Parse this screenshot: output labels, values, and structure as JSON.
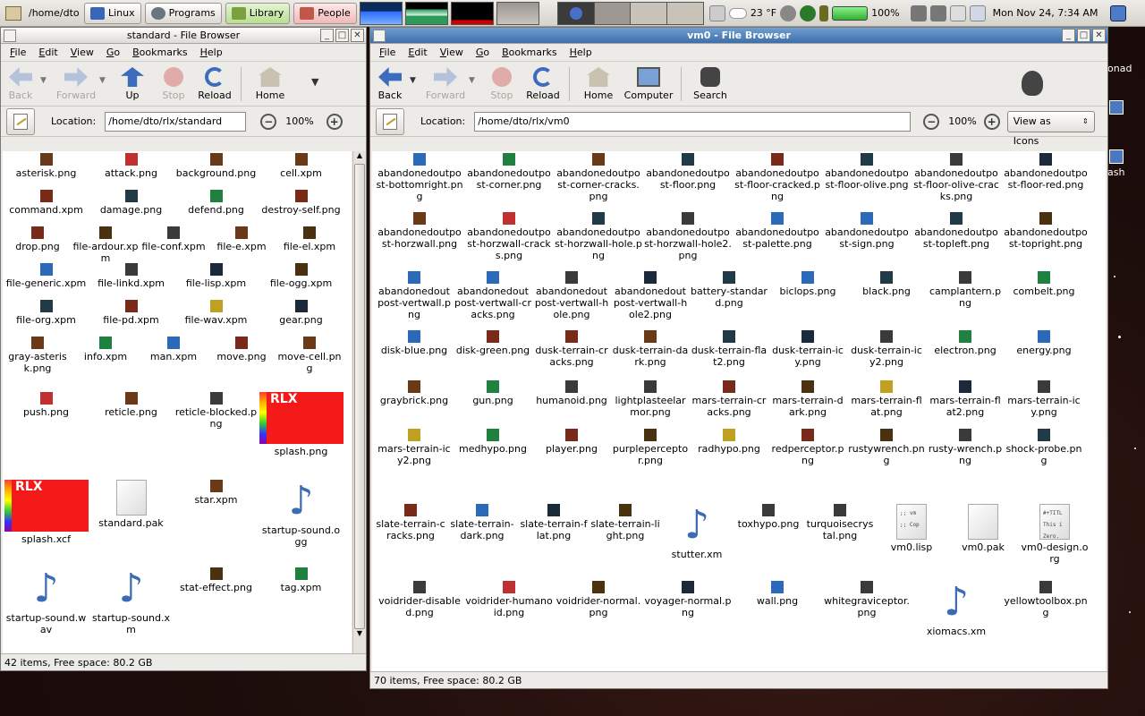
{
  "panel": {
    "path": "/home/dto",
    "buttons": [
      "Linux",
      "Programs",
      "Library",
      "People"
    ],
    "weather": "23 °F",
    "battery": "100%",
    "datetime": "Mon Nov 24,  7:34 AM"
  },
  "desktop": {
    "items": [
      "onad",
      "ash"
    ]
  },
  "left_window": {
    "title": "standard - File Browser",
    "menu": [
      "File",
      "Edit",
      "View",
      "Go",
      "Bookmarks",
      "Help"
    ],
    "toolbar": {
      "back": "Back",
      "forward": "Forward",
      "up": "Up",
      "stop": "Stop",
      "reload": "Reload",
      "home": "Home"
    },
    "location_label": "Location:",
    "location_value": "/home/dto/rlx/standard",
    "zoom": "100%",
    "status": "42 items, Free space: 80.2 GB",
    "files": [
      "asterisk.png",
      "attack.png",
      "background.png",
      "cell.xpm",
      "command.xpm",
      "damage.png",
      "defend.png",
      "destroy-self.png",
      "drop.png",
      "file-ardour.xpm",
      "file-conf.xpm",
      "file-e.xpm",
      "file-el.xpm",
      "file-generic.xpm",
      "file-linkd.xpm",
      "file-lisp.xpm",
      "file-ogg.xpm",
      "file-org.xpm",
      "file-pd.xpm",
      "file-wav.xpm",
      "gear.png",
      "gray-asterisk.png",
      "info.xpm",
      "man.xpm",
      "move.png",
      "move-cell.png",
      "push.png",
      "reticle.png",
      "reticle-blocked.png",
      "splash.png",
      "splash.xcf",
      "standard.pak",
      "star.xpm",
      "startup-sound.ogg",
      "startup-sound.wav",
      "startup-sound.xm",
      "stat-effect.png",
      "tag.xpm"
    ]
  },
  "right_window": {
    "title": "vm0 - File Browser",
    "menu": [
      "File",
      "Edit",
      "View",
      "Go",
      "Bookmarks",
      "Help"
    ],
    "toolbar": {
      "back": "Back",
      "forward": "Forward",
      "stop": "Stop",
      "reload": "Reload",
      "home": "Home",
      "computer": "Computer",
      "search": "Search"
    },
    "location_label": "Location:",
    "location_value": "/home/dto/rlx/vm0",
    "zoom": "100%",
    "view_mode": "View as Icons",
    "status": "70 items, Free space: 80.2 GB",
    "files": [
      "abandonedoutpost-bottomright.png",
      "abandonedoutpost-corner.png",
      "abandonedoutpost-corner-cracks.png",
      "abandonedoutpost-floor.png",
      "abandonedoutpost-floor-cracked.png",
      "abandonedoutpost-floor-olive.png",
      "abandonedoutpost-floor-olive-cracks.png",
      "abandonedoutpost-floor-red.png",
      "abandonedoutpost-horzwall.png",
      "abandonedoutpost-horzwall-cracks.png",
      "abandonedoutpost-horzwall-hole.png",
      "abandonedoutpost-horzwall-hole2.png",
      "abandonedoutpost-palette.png",
      "abandonedoutpost-sign.png",
      "abandonedoutpost-topleft.png",
      "abandonedoutpost-topright.png",
      "abandonedoutpost-vertwall.png",
      "abandonedoutpost-vertwall-cracks.png",
      "abandonedoutpost-vertwall-hole.png",
      "abandonedoutpost-vertwall-hole2.png",
      "battery-standard.png",
      "biclops.png",
      "black.png",
      "camplantern.png",
      "combelt.png",
      "disk-blue.png",
      "disk-green.png",
      "dusk-terrain-cracks.png",
      "dusk-terrain-dark.png",
      "dusk-terrain-flat2.png",
      "dusk-terrain-icy.png",
      "dusk-terrain-icy2.png",
      "electron.png",
      "energy.png",
      "graybrick.png",
      "gun.png",
      "humanoid.png",
      "lightplasteelarmor.png",
      "mars-terrain-cracks.png",
      "mars-terrain-dark.png",
      "mars-terrain-flat.png",
      "mars-terrain-flat2.png",
      "mars-terrain-icy.png",
      "mars-terrain-icy2.png",
      "medhypo.png",
      "player.png",
      "purpleperceptor.png",
      "radhypo.png",
      "redperceptor.png",
      "rustywrench.png",
      "rusty-wrench.png",
      "shock-probe.png",
      "slate-terrain-cracks.png",
      "slate-terrain-dark.png",
      "slate-terrain-flat.png",
      "slate-terrain-light.png",
      "stutter.xm",
      "toxhypo.png",
      "turquoisecrystal.png",
      "vm0.lisp",
      "vm0.pak",
      "vm0-design.org",
      "voidrider-disabled.png",
      "voidrider-humanoid.png",
      "voidrider-normal.png",
      "voyager-normal.png",
      "wall.png",
      "whitegraviceptor.png",
      "xiomacs.xm",
      "yellowtoolbox.png"
    ],
    "doc_previews": {
      "vm0.lisp": ";; vm\n;; Cop",
      "vm0-design.org": "#+TITL\nThis i\nZero."
    }
  },
  "colors": {
    "accent": "#3d6fab",
    "panel": "#dedbd6",
    "desktop": "#1e0e0c"
  }
}
